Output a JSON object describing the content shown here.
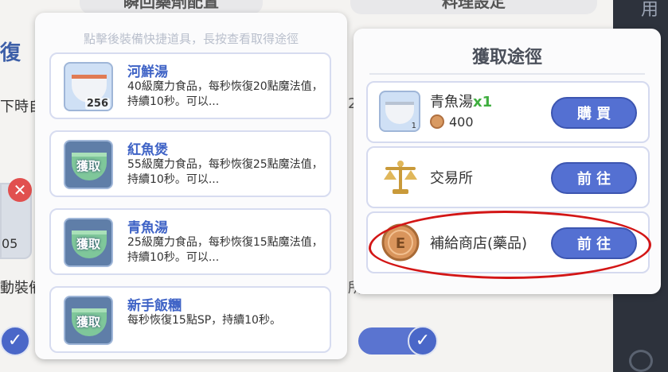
{
  "top_tabs": [
    "瞬回藥劑配置",
    "料理設定"
  ],
  "background": {
    "heading": "復",
    "line1": "下時自",
    "line2_count": "05",
    "line3": "動裝備",
    "right_char": "2",
    "right_char2": "所",
    "dark_side_text": "用"
  },
  "list_panel": {
    "hint": "點擊後裝備快捷道具，長按查看取得途徑",
    "obtain_label": "獲取",
    "items": [
      {
        "name": "河鮮湯",
        "count": "256",
        "desc": "40級魔力食品，每秒恢復20點魔法值，持續10秒。可以..."
      },
      {
        "name": "紅魚煲",
        "count": "",
        "desc": "55級魔力食品，每秒恢復25點魔法值，持續10秒。可以..."
      },
      {
        "name": "青魚湯",
        "count": "",
        "desc": "25級魔力食品，每秒恢復15點魔法值，持續10秒。可以..."
      },
      {
        "name": "新手飯糰",
        "count": "",
        "desc": "每秒恢復15點SP，持續10秒。"
      }
    ]
  },
  "obtain_panel": {
    "title": "獲取途徑",
    "routes": [
      {
        "name": "青魚湯",
        "qty": "x1",
        "icon_count": "1",
        "price": "400",
        "button": "購 買"
      },
      {
        "name": "交易所",
        "button": "前 往"
      },
      {
        "name": "補給商店(藥品)",
        "button": "前 往"
      }
    ]
  },
  "colors": {
    "accent": "#5470d2",
    "annotation": "#d31616"
  }
}
